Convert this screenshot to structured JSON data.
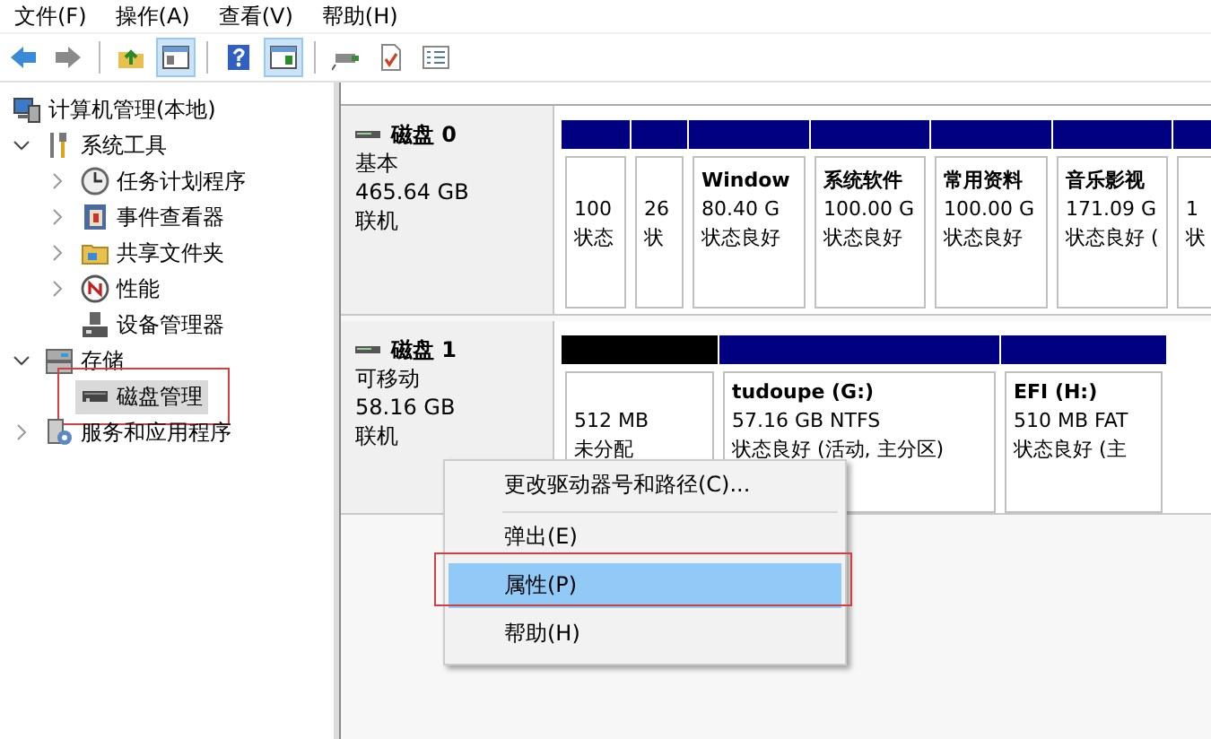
{
  "menu_bar": [
    {
      "label": "文件(F)"
    },
    {
      "label": "操作(A)"
    },
    {
      "label": "查看(V)"
    },
    {
      "label": "帮助(H)"
    }
  ],
  "toolbar": [
    {
      "pressed": false
    },
    {
      "pressed": false
    },
    {
      "pressed": false
    },
    {
      "pressed": true
    },
    {
      "pressed": false
    },
    {
      "pressed": true
    },
    {
      "pressed": false
    },
    {
      "pressed": false
    },
    {
      "pressed": false
    }
  ],
  "tree": [
    {
      "label": "计算机管理(本地)",
      "selected": false,
      "outlined": false,
      "children": [
        {
          "label": "系统工具",
          "selected": false,
          "outlined": false,
          "expanded": true,
          "children": [
            {
              "label": "任务计划程序",
              "selected": false,
              "outlined": false,
              "expanded": false
            },
            {
              "label": "事件查看器",
              "selected": false,
              "outlined": false,
              "expanded": false
            },
            {
              "label": "共享文件夹",
              "selected": false,
              "outlined": false,
              "expanded": false
            },
            {
              "label": "性能",
              "selected": false,
              "outlined": false,
              "expanded": false
            },
            {
              "label": "设备管理器",
              "selected": false,
              "outlined": false
            }
          ]
        },
        {
          "label": "存储",
          "selected": false,
          "outlined": false,
          "expanded": true,
          "children": [
            {
              "label": "磁盘管理",
              "selected": true,
              "outlined": true
            }
          ]
        },
        {
          "label": "服务和应用程序",
          "selected": false,
          "outlined": false,
          "expanded": false
        }
      ]
    }
  ],
  "disks": [
    {
      "name": "磁盘 0",
      "type": "基本",
      "size": "465.64 GB",
      "status": "联机",
      "partitions": [
        {
          "color": "#000080",
          "size": "100",
          "status": "状态"
        },
        {
          "color": "#000080",
          "size": "26",
          "status": "状"
        },
        {
          "color": "#000080",
          "title": "Window",
          "size": "80.40 G",
          "status": "状态良好"
        },
        {
          "color": "#000080",
          "title": "系统软件",
          "size": "100.00 G",
          "status": "状态良好"
        },
        {
          "color": "#000080",
          "title": "常用资料",
          "size": "100.00 G",
          "status": "状态良好"
        },
        {
          "color": "#000080",
          "title": "音乐影视",
          "size": "171.09 G",
          "status": "状态良好 ("
        },
        {
          "color": "#000080",
          "size": "1",
          "status": "状"
        }
      ]
    },
    {
      "name": "磁盘 1",
      "type": "可移动",
      "size": "58.16 GB",
      "status": "联机",
      "partitions": [
        {
          "color": "#000000",
          "size": "512 MB",
          "status": "未分配"
        },
        {
          "color": "#000080",
          "title": "tudoupe  (G:)",
          "size": "57.16 GB NTFS",
          "status": "状态良好 (活动, 主分区)"
        },
        {
          "color": "#000080",
          "title": "EFI  (H:)",
          "size": "510 MB FAT",
          "status": "状态良好 (主"
        }
      ]
    }
  ],
  "context_menu": [
    {
      "kind": "item",
      "label": "更改驱动器号和路径(C)...",
      "selected": false
    },
    {
      "kind": "separator"
    },
    {
      "kind": "item",
      "label": "弹出(E)",
      "selected": false
    },
    {
      "kind": "item",
      "label": "属性(P)",
      "selected": true,
      "outlined": true
    },
    {
      "kind": "item",
      "label": "帮助(H)",
      "selected": false
    }
  ]
}
